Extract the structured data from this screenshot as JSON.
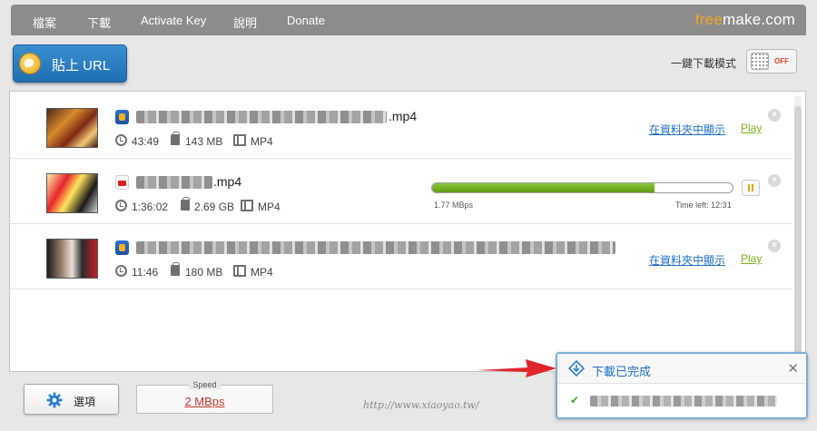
{
  "menu": {
    "items": [
      "檔案",
      "下載",
      "Activate Key",
      "說明",
      "Donate"
    ]
  },
  "brand": {
    "free": "free",
    "make": "make.com"
  },
  "toolbar": {
    "paste_url_label": "貼上 URL",
    "one_click_label": "一鍵下載模式",
    "toggle_state": "OFF"
  },
  "downloads": [
    {
      "title_suffix": ".mp4",
      "site_icon": "generic-video-site-icon",
      "duration": "43:49",
      "size": "143 MB",
      "format": "MP4",
      "status": "completed",
      "show_in_folder": "在資料夾中顯示",
      "play": "Play"
    },
    {
      "title_suffix": ".mp4",
      "site_icon": "youtube-icon",
      "duration": "1:36:02",
      "size": "2.69 GB",
      "format": "MP4",
      "status": "downloading",
      "progress": 0.74,
      "speed": "1.77  MBps",
      "time_left": "Time left: 12:31"
    },
    {
      "title_suffix": "",
      "site_icon": "generic-video-site-icon",
      "duration": "11:46",
      "size": "180 MB",
      "format": "MP4",
      "status": "completed",
      "show_in_folder": "在資料夾中顯示",
      "play": "Play"
    }
  ],
  "bottom": {
    "options_label": "選項",
    "speed_label": "Speed",
    "speed_value": "2  MBps"
  },
  "notification": {
    "title": "下載已完成",
    "check": "✔"
  },
  "watermark": "http://www.xiaoyao.tw/",
  "colors": {
    "accent_blue": "#1d6fc9",
    "play_green": "#7ab51d",
    "progress_green": "#6fb021",
    "speed_red": "#c0392b",
    "brand_orange": "#f5a623"
  }
}
